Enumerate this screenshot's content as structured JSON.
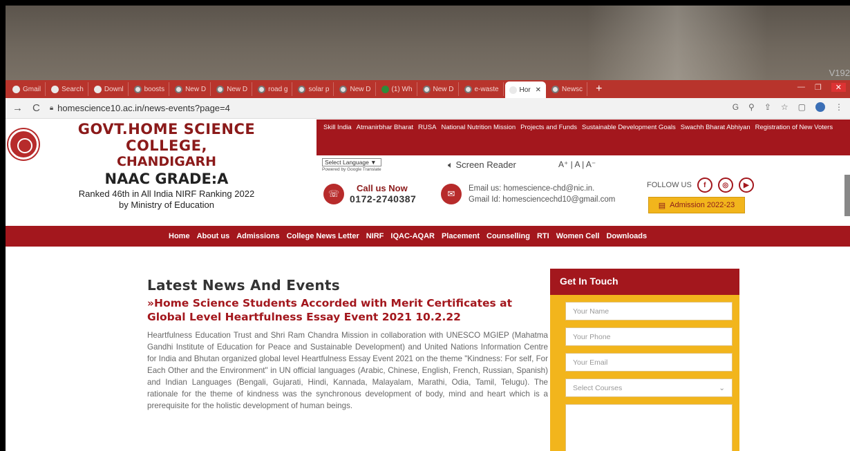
{
  "wall": {
    "corner_text": "V192"
  },
  "browser": {
    "tabs": [
      {
        "label": "Gmail",
        "icon": "gmail-icon"
      },
      {
        "label": "Search",
        "icon": "search-tab-icon"
      },
      {
        "label": "Downl",
        "icon": "download-icon"
      },
      {
        "label": "boosts",
        "icon": "globe-icon"
      },
      {
        "label": "New D",
        "icon": "globe-icon"
      },
      {
        "label": "New D",
        "icon": "globe-icon"
      },
      {
        "label": "road g",
        "icon": "globe-icon"
      },
      {
        "label": "solar p",
        "icon": "globe-icon"
      },
      {
        "label": "New D",
        "icon": "globe-icon"
      },
      {
        "label": "(1) Wh",
        "icon": "whatsapp-icon"
      },
      {
        "label": "New D",
        "icon": "globe-icon"
      },
      {
        "label": "e-waste",
        "icon": "globe-icon"
      },
      {
        "label": "Hor",
        "icon": "college-icon",
        "active": true
      },
      {
        "label": "Newsc",
        "icon": "globe-icon"
      }
    ],
    "new_tab": "+",
    "url": "homescience10.ac.in/news-events?page=4"
  },
  "header": {
    "college_line1": "GOVT.HOME SCIENCE COLLEGE,",
    "college_line2": "CHANDIGARH",
    "naac": "NAAC GRADE:A",
    "rank_line1": "Ranked 46th in All India NIRF Ranking 2022",
    "rank_line2": "by Ministry of Education",
    "top_links": [
      "Skill India",
      "Atmanirbhar Bharat",
      "RUSA",
      "National Nutrition Mission",
      "Projects and Funds",
      "Sustainable Development Goals",
      "Swachh Bharat Abhiyan",
      "Registration of New Voters"
    ],
    "language_select": "Select Language ▼",
    "powered_by": "Powered by Google Translate",
    "screen_reader": "Screen Reader",
    "font_sizes": "A⁺ | A | A⁻",
    "call_label": "Call us Now",
    "phone": "0172-2740387",
    "email_line": "Email us: homescience-chd@nic.in.",
    "gmail_line": "Gmail Id: homesciencechd10@gmail.com",
    "follow_us": "FOLLOW US",
    "admission": "Admission 2022-23"
  },
  "mainnav": [
    "Home",
    "About us",
    "Admissions",
    "College News Letter",
    "NIRF",
    "IQAC-AQAR",
    "Placement",
    "Counselling",
    "RTI",
    "Women Cell",
    "Downloads"
  ],
  "content": {
    "heading": "Latest News And Events",
    "news_title": "»Home Science Students Accorded with Merit Certificates at Global Level Heartfulness Essay Event 2021 10.2.22",
    "body": "Heartfulness Education Trust and Shri Ram Chandra Mission in collaboration with UNESCO MGIEP (Mahatma Gandhi Institute of Education for Peace and Sustainable Development) and United Nations Information Centre for India and Bhutan organized global level Heartfulness Essay Event 2021 on the theme \"Kindness: For self, For Each Other and the Environment\" in UN official languages (Arabic, Chinese, English, French, Russian, Spanish) and Indian Languages (Bengali, Gujarati, Hindi, Kannada, Malayalam, Marathi, Odia, Tamil, Telugu). The rationale for the theme of kindness was the synchronous development of body, mind and heart which is a prerequisite for the holistic development of human beings."
  },
  "contact_form": {
    "title": "Get In Touch",
    "name_placeholder": "Your Name",
    "phone_placeholder": "Your Phone",
    "email_placeholder": "Your Email",
    "course_select": "Select Courses"
  }
}
